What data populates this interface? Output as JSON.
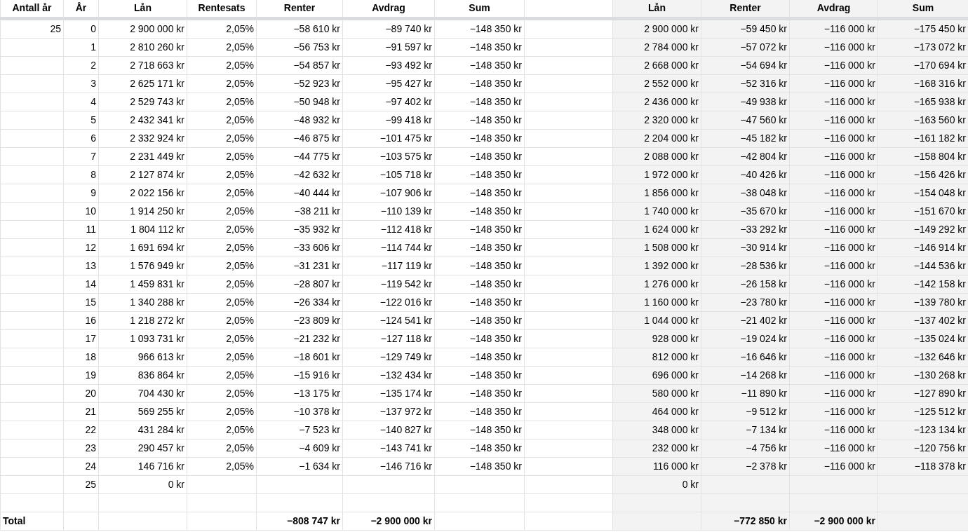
{
  "column_groups": [
    {
      "kind": "main",
      "columns": [
        {
          "label": "Antall år"
        },
        {
          "label": "År"
        },
        {
          "label": "Lån"
        },
        {
          "label": "Rentesats"
        },
        {
          "label": "Renter"
        },
        {
          "label": "Avdrag"
        },
        {
          "label": "Sum"
        },
        {}
      ]
    },
    {
      "kind": "comparison",
      "columns": [
        {
          "label": "Lån"
        },
        {
          "label": "Renter"
        },
        {
          "label": "Avdrag"
        },
        {
          "label": "Sum"
        }
      ]
    }
  ],
  "rows": [
    {
      "kind": "data",
      "cells": [
        "25",
        "0",
        "2 900 000 kr",
        "2,05%",
        "−58 610 kr",
        "−89 740 kr",
        "−148 350 kr",
        null,
        "2 900 000 kr",
        "−59 450 kr",
        "−116 000 kr",
        "−175 450 kr"
      ]
    },
    {
      "kind": "data",
      "cells": [
        null,
        "1",
        "2 810 260 kr",
        "2,05%",
        "−56 753 kr",
        "−91 597 kr",
        "−148 350 kr",
        null,
        "2 784 000 kr",
        "−57 072 kr",
        "−116 000 kr",
        "−173 072 kr"
      ]
    },
    {
      "kind": "data",
      "cells": [
        null,
        "2",
        "2 718 663 kr",
        "2,05%",
        "−54 857 kr",
        "−93 492 kr",
        "−148 350 kr",
        null,
        "2 668 000 kr",
        "−54 694 kr",
        "−116 000 kr",
        "−170 694 kr"
      ]
    },
    {
      "kind": "data",
      "cells": [
        null,
        "3",
        "2 625 171 kr",
        "2,05%",
        "−52 923 kr",
        "−95 427 kr",
        "−148 350 kr",
        null,
        "2 552 000 kr",
        "−52 316 kr",
        "−116 000 kr",
        "−168 316 kr"
      ]
    },
    {
      "kind": "data",
      "cells": [
        null,
        "4",
        "2 529 743 kr",
        "2,05%",
        "−50 948 kr",
        "−97 402 kr",
        "−148 350 kr",
        null,
        "2 436 000 kr",
        "−49 938 kr",
        "−116 000 kr",
        "−165 938 kr"
      ]
    },
    {
      "kind": "data",
      "cells": [
        null,
        "5",
        "2 432 341 kr",
        "2,05%",
        "−48 932 kr",
        "−99 418 kr",
        "−148 350 kr",
        null,
        "2 320 000 kr",
        "−47 560 kr",
        "−116 000 kr",
        "−163 560 kr"
      ]
    },
    {
      "kind": "data",
      "cells": [
        null,
        "6",
        "2 332 924 kr",
        "2,05%",
        "−46 875 kr",
        "−101 475 kr",
        "−148 350 kr",
        null,
        "2 204 000 kr",
        "−45 182 kr",
        "−116 000 kr",
        "−161 182 kr"
      ]
    },
    {
      "kind": "data",
      "cells": [
        null,
        "7",
        "2 231 449 kr",
        "2,05%",
        "−44 775 kr",
        "−103 575 kr",
        "−148 350 kr",
        null,
        "2 088 000 kr",
        "−42 804 kr",
        "−116 000 kr",
        "−158 804 kr"
      ]
    },
    {
      "kind": "data",
      "cells": [
        null,
        "8",
        "2 127 874 kr",
        "2,05%",
        "−42 632 kr",
        "−105 718 kr",
        "−148 350 kr",
        null,
        "1 972 000 kr",
        "−40 426 kr",
        "−116 000 kr",
        "−156 426 kr"
      ]
    },
    {
      "kind": "data",
      "cells": [
        null,
        "9",
        "2 022 156 kr",
        "2,05%",
        "−40 444 kr",
        "−107 906 kr",
        "−148 350 kr",
        null,
        "1 856 000 kr",
        "−38 048 kr",
        "−116 000 kr",
        "−154 048 kr"
      ]
    },
    {
      "kind": "data",
      "cells": [
        null,
        "10",
        "1 914 250 kr",
        "2,05%",
        "−38 211 kr",
        "−110 139 kr",
        "−148 350 kr",
        null,
        "1 740 000 kr",
        "−35 670 kr",
        "−116 000 kr",
        "−151 670 kr"
      ]
    },
    {
      "kind": "data",
      "cells": [
        null,
        "11",
        "1 804 112 kr",
        "2,05%",
        "−35 932 kr",
        "−112 418 kr",
        "−148 350 kr",
        null,
        "1 624 000 kr",
        "−33 292 kr",
        "−116 000 kr",
        "−149 292 kr"
      ]
    },
    {
      "kind": "data",
      "cells": [
        null,
        "12",
        "1 691 694 kr",
        "2,05%",
        "−33 606 kr",
        "−114 744 kr",
        "−148 350 kr",
        null,
        "1 508 000 kr",
        "−30 914 kr",
        "−116 000 kr",
        "−146 914 kr"
      ]
    },
    {
      "kind": "data",
      "cells": [
        null,
        "13",
        "1 576 949 kr",
        "2,05%",
        "−31 231 kr",
        "−117 119 kr",
        "−148 350 kr",
        null,
        "1 392 000 kr",
        "−28 536 kr",
        "−116 000 kr",
        "−144 536 kr"
      ]
    },
    {
      "kind": "data",
      "cells": [
        null,
        "14",
        "1 459 831 kr",
        "2,05%",
        "−28 807 kr",
        "−119 542 kr",
        "−148 350 kr",
        null,
        "1 276 000 kr",
        "−26 158 kr",
        "−116 000 kr",
        "−142 158 kr"
      ]
    },
    {
      "kind": "data",
      "cells": [
        null,
        "15",
        "1 340 288 kr",
        "2,05%",
        "−26 334 kr",
        "−122 016 kr",
        "−148 350 kr",
        null,
        "1 160 000 kr",
        "−23 780 kr",
        "−116 000 kr",
        "−139 780 kr"
      ]
    },
    {
      "kind": "data",
      "cells": [
        null,
        "16",
        "1 218 272 kr",
        "2,05%",
        "−23 809 kr",
        "−124 541 kr",
        "−148 350 kr",
        null,
        "1 044 000 kr",
        "−21 402 kr",
        "−116 000 kr",
        "−137 402 kr"
      ]
    },
    {
      "kind": "data",
      "cells": [
        null,
        "17",
        "1 093 731 kr",
        "2,05%",
        "−21 232 kr",
        "−127 118 kr",
        "−148 350 kr",
        null,
        "928 000 kr",
        "−19 024 kr",
        "−116 000 kr",
        "−135 024 kr"
      ]
    },
    {
      "kind": "data",
      "cells": [
        null,
        "18",
        "966 613 kr",
        "2,05%",
        "−18 601 kr",
        "−129 749 kr",
        "−148 350 kr",
        null,
        "812 000 kr",
        "−16 646 kr",
        "−116 000 kr",
        "−132 646 kr"
      ]
    },
    {
      "kind": "data",
      "cells": [
        null,
        "19",
        "836 864 kr",
        "2,05%",
        "−15 916 kr",
        "−132 434 kr",
        "−148 350 kr",
        null,
        "696 000 kr",
        "−14 268 kr",
        "−116 000 kr",
        "−130 268 kr"
      ]
    },
    {
      "kind": "data",
      "cells": [
        null,
        "20",
        "704 430 kr",
        "2,05%",
        "−13 175 kr",
        "−135 174 kr",
        "−148 350 kr",
        null,
        "580 000 kr",
        "−11 890 kr",
        "−116 000 kr",
        "−127 890 kr"
      ]
    },
    {
      "kind": "data",
      "cells": [
        null,
        "21",
        "569 255 kr",
        "2,05%",
        "−10 378 kr",
        "−137 972 kr",
        "−148 350 kr",
        null,
        "464 000 kr",
        "−9 512 kr",
        "−116 000 kr",
        "−125 512 kr"
      ]
    },
    {
      "kind": "data",
      "cells": [
        null,
        "22",
        "431 284 kr",
        "2,05%",
        "−7 523 kr",
        "−140 827 kr",
        "−148 350 kr",
        null,
        "348 000 kr",
        "−7 134 kr",
        "−116 000 kr",
        "−123 134 kr"
      ]
    },
    {
      "kind": "data",
      "cells": [
        null,
        "23",
        "290 457 kr",
        "2,05%",
        "−4 609 kr",
        "−143 741 kr",
        "−148 350 kr",
        null,
        "232 000 kr",
        "−4 756 kr",
        "−116 000 kr",
        "−120 756 kr"
      ]
    },
    {
      "kind": "data",
      "cells": [
        null,
        "24",
        "146 716 kr",
        "2,05%",
        "−1 634 kr",
        "−146 716 kr",
        "−148 350 kr",
        null,
        "116 000 kr",
        "−2 378 kr",
        "−116 000 kr",
        "−118 378 kr"
      ]
    },
    {
      "kind": "data",
      "cells": [
        null,
        "25",
        "0 kr",
        null,
        null,
        null,
        null,
        null,
        "0 kr",
        null,
        null,
        null
      ]
    },
    {
      "kind": "data",
      "cells": [
        null,
        null,
        null,
        null,
        null,
        null,
        null,
        null,
        null,
        null,
        null,
        null
      ]
    },
    {
      "kind": "total",
      "cells": [
        "Total",
        null,
        null,
        null,
        "−808 747 kr",
        "−2 900 000 kr",
        null,
        null,
        null,
        "−772 850 kr",
        "−2 900 000 kr",
        null
      ]
    }
  ]
}
